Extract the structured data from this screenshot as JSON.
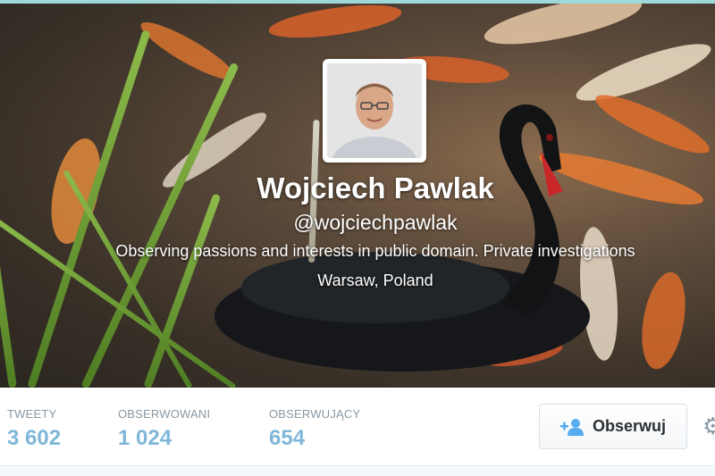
{
  "profile": {
    "name": "Wojciech Pawlak",
    "handle": "@wojciechpawlak",
    "bio": "Observing passions and interests in public domain. Private investigations",
    "location": "Warsaw, Poland"
  },
  "stats": [
    {
      "label": "TWEETY",
      "value": "3 602"
    },
    {
      "label": "OBSERWOWANI",
      "value": "1 024"
    },
    {
      "label": "OBSERWUJĄCY",
      "value": "654"
    }
  ],
  "actions": {
    "follow_label": "Obserwuj",
    "follow_icon": "add-user-icon",
    "settings_icon": "gear-icon"
  },
  "colors": {
    "stat_value": "#7fb7d9",
    "stat_label": "#8899a6"
  }
}
